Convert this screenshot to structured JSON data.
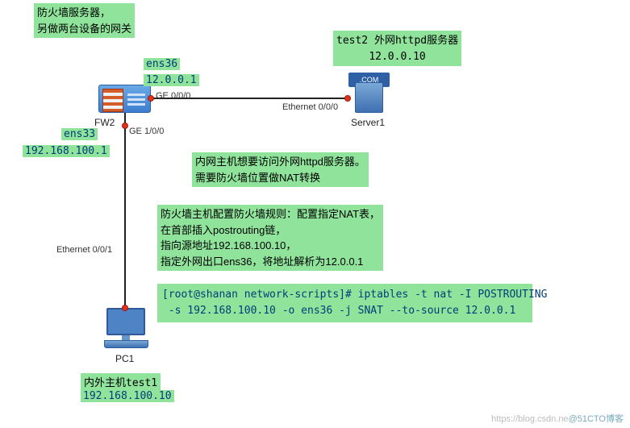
{
  "notes": {
    "fw_desc_line1": "防火墙服务器，",
    "fw_desc_line2": "另做两台设备的网关",
    "test2_line1": "test2 外网httpd服务器",
    "test2_line2": "12.0.0.10",
    "intent_line1": "内网主机想要访问外网httpd服务器。",
    "intent_line2": "需要防火墙位置做NAT转换",
    "rule_line1": "防火墙主机配置防火墙规则：配置指定NAT表，",
    "rule_line2": "在首部插入postrouting链，",
    "rule_line3": "指向源地址192.168.100.10，",
    "rule_line4": "指定外网出口ens36，将地址解析为12.0.0.1",
    "terminal": "[root@shanan network-scripts]# iptables -t nat -I POSTROUTING\n -s 192.168.100.10 -o ens36 -j SNAT --to-source 12.0.0.1",
    "test1_label": "内外主机test1",
    "test1_ip": "192.168.100.10"
  },
  "interfaces": {
    "ens36": "ens36",
    "ens36_ip": "12.0.0.1",
    "ens33": "ens33",
    "ens33_ip": "192.168.100.1"
  },
  "ports": {
    "ge000": "GE 0/0/0",
    "ge100": "GE 1/0/0",
    "eth000_srv": "Ethernet 0/0/0",
    "eth001_pc": "Ethernet 0/0/1"
  },
  "devices": {
    "fw": "FW2",
    "server": "Server1",
    "pc": "PC1",
    "server_banner": ".COM"
  },
  "watermark": {
    "left": "https://blog.csdn.ne",
    "right": "@51CTO博客"
  }
}
